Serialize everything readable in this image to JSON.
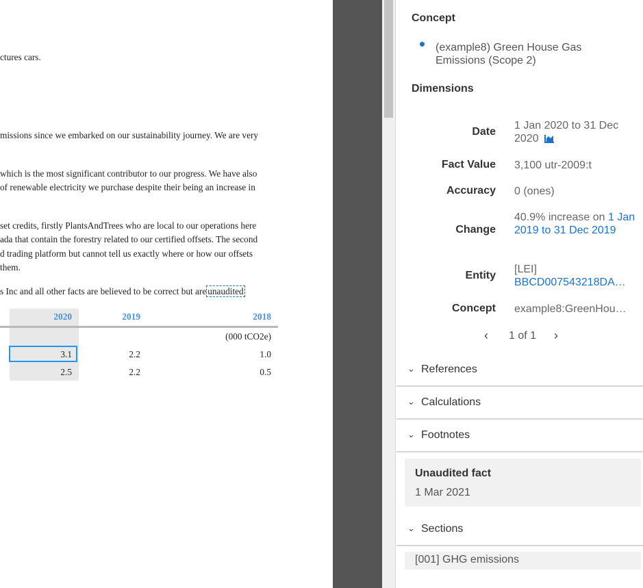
{
  "document": {
    "lines": [
      "ctures cars.",
      "missions since we embarked on our sustainability journey. We are very",
      "which is the most significant contributor to our progress. We have also",
      " of renewable electricity we purchase despite their being an increase in",
      "set credits, firstly PlantsAndTrees who are local to our operations here",
      "ada that contain the forestry related to our certified offsets. The second",
      "d trading platform but cannot tell us exactly where or how our offsets",
      " them.",
      "s Inc and all other facts are believed to be correct but are"
    ],
    "highlighted_word": "unaudited",
    "table": {
      "headers": [
        "2020",
        "2019",
        "2018"
      ],
      "unit": "(000 tCO2e)",
      "rows": [
        [
          "3.1",
          "2.2",
          "1.0"
        ],
        [
          "2.5",
          "2.2",
          "0.5"
        ]
      ]
    }
  },
  "panel": {
    "concept_heading": "Concept",
    "concept_value": "(example8) Green House Gas Emissions (Scope 2)",
    "dimensions_heading": "Dimensions",
    "date_label": "Date",
    "date_value": "1 Jan 2020 to 31 Dec 2020",
    "fact_value_label": "Fact Value",
    "fact_value": "3,100 utr-2009:t",
    "accuracy_label": "Accuracy",
    "accuracy_value": "0 (ones)",
    "change_label": "Change",
    "change_prefix": "40.9% increase on ",
    "change_link": "1 Jan 2019 to 31 Dec 2019",
    "entity_label": "Entity",
    "entity_scheme": "[LEI]",
    "entity_value": "BBCD007543218DA…",
    "concept_label": "Concept",
    "concept_name": "example8:GreenHou…",
    "pager": "1 of 1",
    "sections": {
      "references": "References",
      "calculations": "Calculations",
      "footnotes": "Footnotes",
      "sections": "Sections"
    },
    "footnote_title": "Unaudited fact",
    "footnote_date": "1 Mar 2021",
    "section_item": "[001] GHG emissions"
  },
  "colors": {
    "accent": "#1a73c8",
    "selection_border": "#2196f3",
    "gutter": "#555555"
  }
}
